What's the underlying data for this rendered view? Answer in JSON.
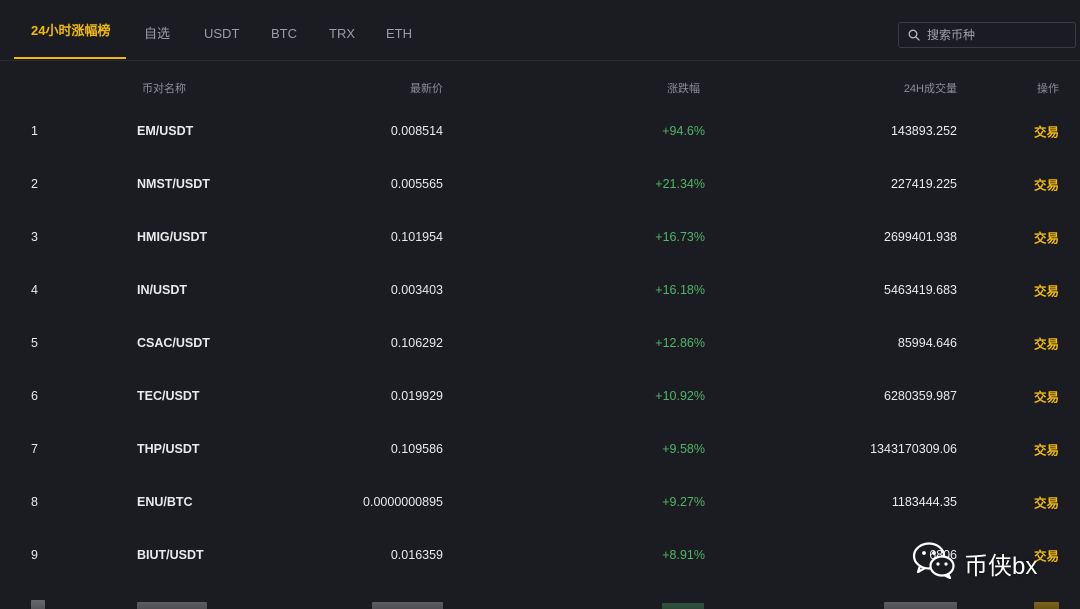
{
  "tabs": [
    {
      "label": "24小时涨幅榜",
      "active": true
    },
    {
      "label": "自选",
      "active": false
    },
    {
      "label": "USDT",
      "active": false
    },
    {
      "label": "BTC",
      "active": false
    },
    {
      "label": "TRX",
      "active": false
    },
    {
      "label": "ETH",
      "active": false
    }
  ],
  "search": {
    "placeholder": "搜索币种"
  },
  "table": {
    "headers": {
      "pair": "币对名称",
      "price": "最新价",
      "change": "涨跌幅",
      "volume": "24H成交量",
      "action": "操作"
    },
    "rows": [
      {
        "idx": "1",
        "pair": "EM/USDT",
        "price": "0.008514",
        "change": "+94.6%",
        "volume": "143893.252",
        "action": "交易"
      },
      {
        "idx": "2",
        "pair": "NMST/USDT",
        "price": "0.005565",
        "change": "+21.34%",
        "volume": "227419.225",
        "action": "交易"
      },
      {
        "idx": "3",
        "pair": "HMIG/USDT",
        "price": "0.101954",
        "change": "+16.73%",
        "volume": "2699401.938",
        "action": "交易"
      },
      {
        "idx": "4",
        "pair": "IN/USDT",
        "price": "0.003403",
        "change": "+16.18%",
        "volume": "5463419.683",
        "action": "交易"
      },
      {
        "idx": "5",
        "pair": "CSAC/USDT",
        "price": "0.106292",
        "change": "+12.86%",
        "volume": "85994.646",
        "action": "交易"
      },
      {
        "idx": "6",
        "pair": "TEC/USDT",
        "price": "0.019929",
        "change": "+10.92%",
        "volume": "6280359.987",
        "action": "交易"
      },
      {
        "idx": "7",
        "pair": "THP/USDT",
        "price": "0.109586",
        "change": "+9.58%",
        "volume": "1343170309.06",
        "action": "交易"
      },
      {
        "idx": "8",
        "pair": "ENU/BTC",
        "price": "0.0000000895",
        "change": "+9.27%",
        "volume": "1183444.35",
        "action": "交易"
      },
      {
        "idx": "9",
        "pair": "BIUT/USDT",
        "price": "0.016359",
        "change": "+8.91%",
        "volume": "6806",
        "action": "交易"
      }
    ]
  },
  "watermark": {
    "text": "币侠bx",
    "icon": "wechat-icon"
  },
  "colors": {
    "background": "#1b1c21",
    "accent": "#f0b90b",
    "positive": "#4fb56a",
    "muted": "#8c8e98"
  }
}
